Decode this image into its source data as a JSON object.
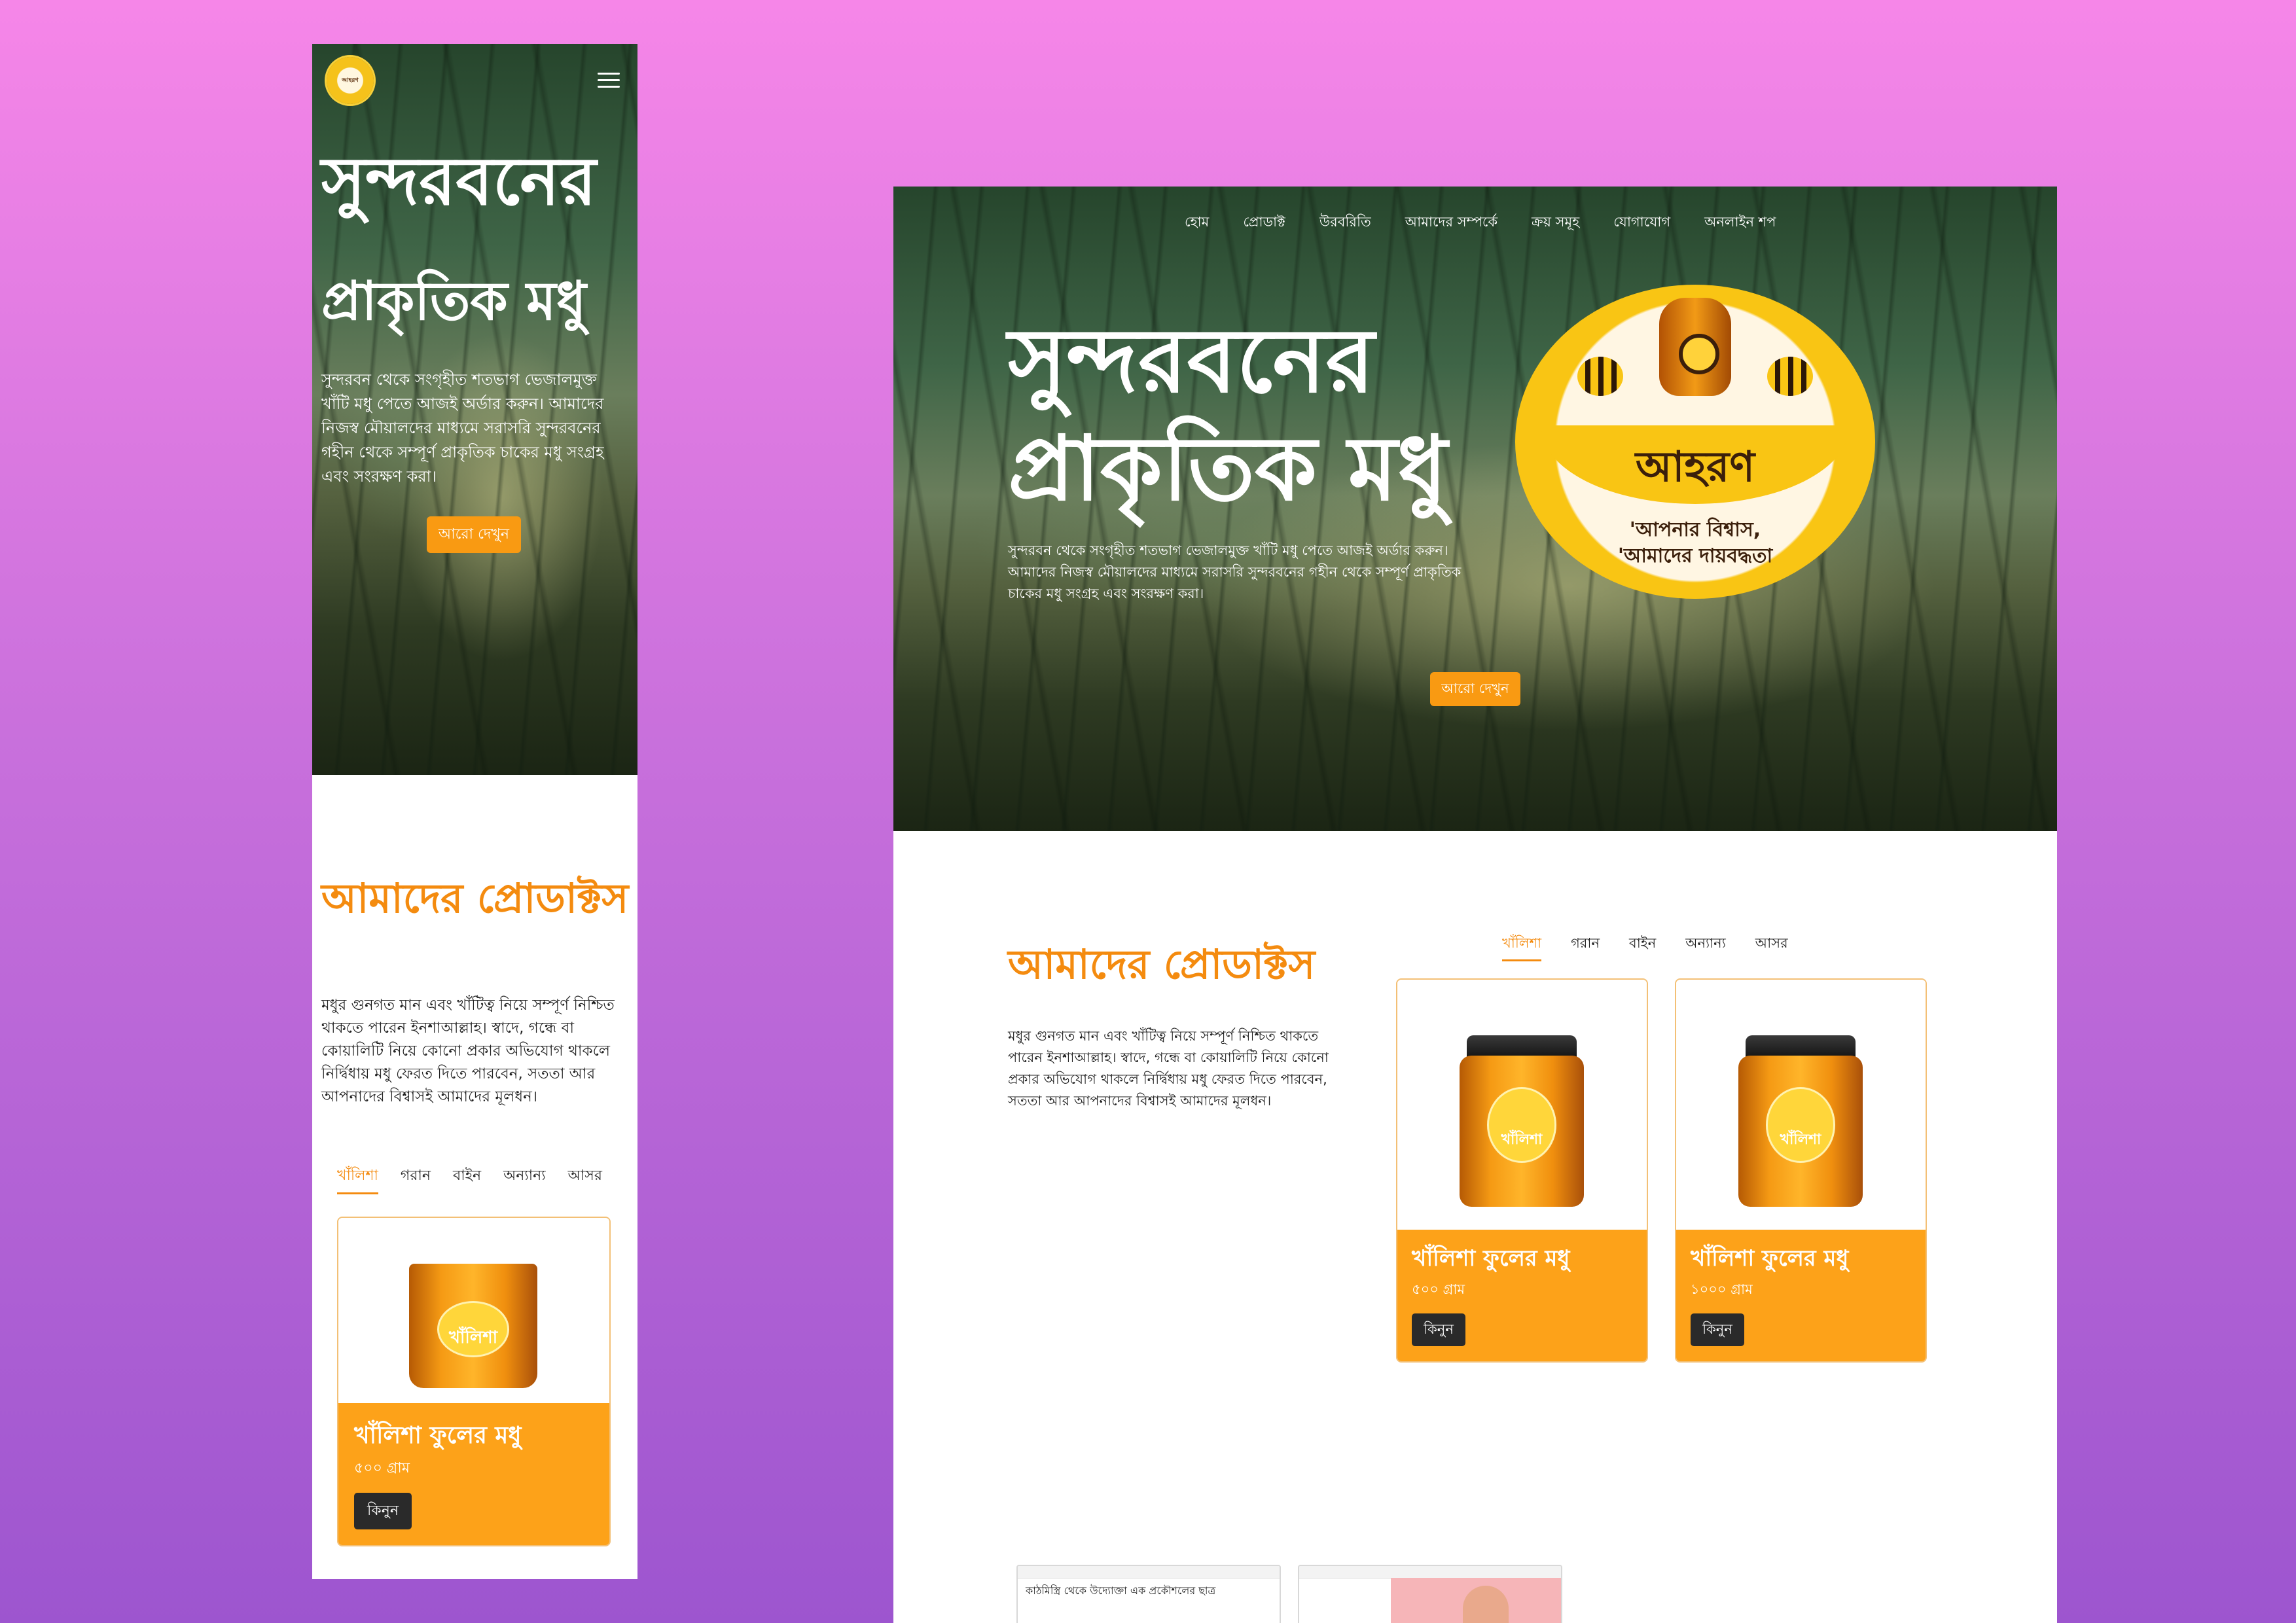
{
  "mobile": {
    "hero": {
      "title_line1": "সুন্দরবনের",
      "title_line2": "প্রাকৃতিক মধু",
      "description": "সুন্দরবন থেকে সংগৃহীত শতভাগ ভেজালমুক্ত খাঁটি মধু পেতে আজই অর্ডার করুন। আমাদের নিজস্ব মৌয়ালদের মাধ্যমে সরাসরি সুন্দরবনের গহীন থেকে সম্পূর্ণ প্রাকৃতিক চাকের মধু সংগ্রহ এবং সংরক্ষণ করা।",
      "more_button": "আরো দেখুন"
    },
    "products": {
      "title": "আমাদের প্রোডাক্টস",
      "description": "মধুর গুনগত মান এবং খাঁটিত্ব নিয়ে সম্পূর্ণ নিশ্চিত থাকতে পারেন ইনশাআল্লাহ। স্বাদে, গন্ধে বা কোয়ালিটি নিয়ে কোনো প্রকার অভিযোগ থাকলে নির্দ্বিধায় মধু ফেরত দিতে পারবেন, সততা আর আপনাদের বিশ্বাসই আমাদের মূলধন।",
      "tabs": [
        "খাঁলিশা",
        "গরান",
        "বাইন",
        "অন্যান্য",
        "আসর"
      ],
      "card": {
        "jar_label": "খাঁলিশা",
        "name": "খাঁলিশা ফুলের মধু",
        "weight": "৫০০ গ্রাম",
        "buy": "কিনুন"
      }
    }
  },
  "desktop": {
    "nav": [
      "হোম",
      "প্রোডাক্ট",
      "উরবরিতি",
      "আমাদের সম্পর্কে",
      "ক্রয় সমূহ",
      "যোগাযোগ",
      "অনলাইন শপ"
    ],
    "hero": {
      "title_line1": "সুন্দরবনের",
      "title_line2": "প্রাকৃতিক মধু",
      "description": "সুন্দরবন থেকে সংগৃহীত শতভাগ ভেজালমুক্ত খাঁটি মধু পেতে আজই অর্ডার করুন। আমাদের নিজস্ব মৌয়ালদের মাধ্যমে সরাসরি সুন্দরবনের গহীন থেকে সম্পূর্ণ প্রাকৃতিক চাকের মধু সংগ্রহ এবং সংরক্ষণ করা।",
      "more_button": "আরো দেখুন"
    },
    "badge": {
      "brand": "আহরণ",
      "slogan_line1": "'আপনার বিশ্বাস,",
      "slogan_line2": "'আমাদের দায়বদ্ধতা"
    },
    "products": {
      "title": "আমাদের প্রোডাক্টস",
      "description": "মধুর গুনগত মান এবং খাঁটিত্ব নিয়ে সম্পূর্ণ নিশ্চিত থাকতে পারেন ইনশাআল্লাহ। স্বাদে, গন্ধে বা কোয়ালিটি নিয়ে কোনো প্রকার অভিযোগ থাকলে নির্দ্বিধায় মধু ফেরত দিতে পারবেন, সততা আর আপনাদের বিশ্বাসই আমাদের মূলধন।",
      "tabs": [
        "খাঁলিশা",
        "গরান",
        "বাইন",
        "অন্যান্য",
        "আসর"
      ],
      "cards": [
        {
          "jar_label": "খাঁলিশা",
          "name": "খাঁলিশা ফুলের মধু",
          "weight": "৫০০ গ্রাম",
          "buy": "কিনুন"
        },
        {
          "jar_label": "খাঁলিশা",
          "name": "খাঁলিশা ফুলের মধু",
          "weight": "১০০০ গ্রাম",
          "buy": "কিনুন"
        }
      ]
    },
    "news": {
      "thumb1_title": "কাঠমিস্ত্রি থেকে উদ্যোক্তা এক প্রকৌশলের ছাত্র"
    }
  },
  "colors": {
    "accent": "#f48b0f",
    "button": "#f99a12",
    "card_info": "#fda219",
    "buy_button": "#2a2a2a",
    "badge_yellow": "#f9c514",
    "background_top": "#f686e8",
    "background_bottom": "#9d55cf"
  },
  "icons": {
    "menu": "hamburger-menu-icon",
    "logo": "honey-pot-logo"
  }
}
